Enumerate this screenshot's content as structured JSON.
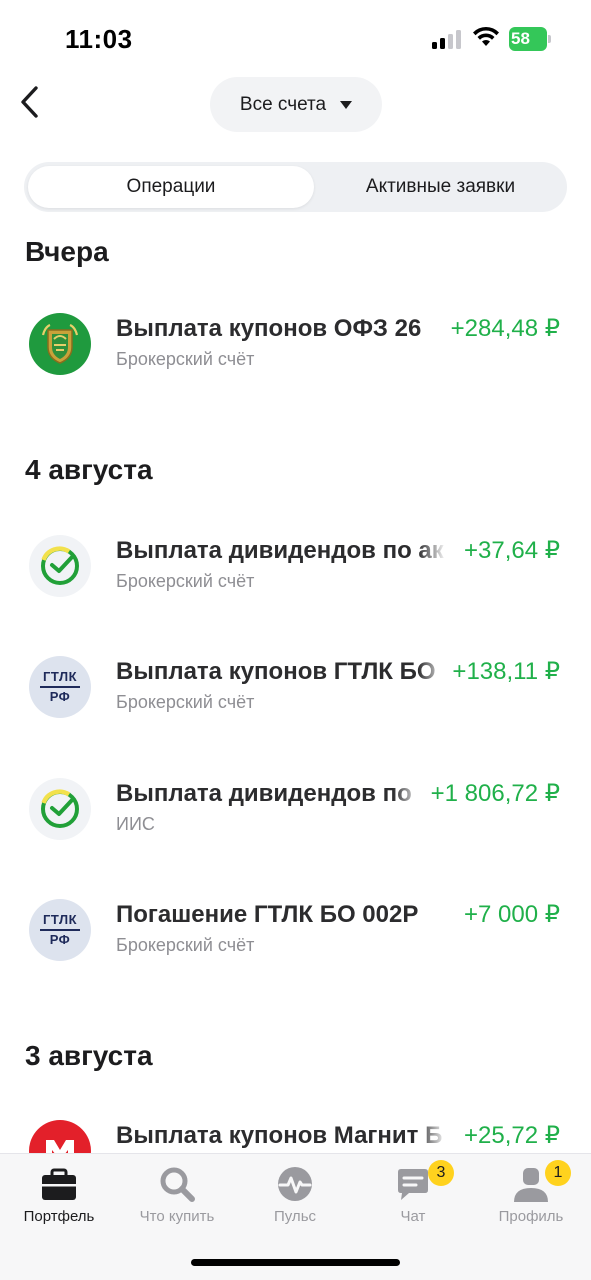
{
  "status_bar": {
    "time": "11:03",
    "battery": "58"
  },
  "header": {
    "account_selector": "Все счета"
  },
  "tabs": {
    "active": "Операции",
    "inactive": "Активные заявки"
  },
  "sections": [
    {
      "title": "Вчера"
    },
    {
      "title": "4 августа"
    },
    {
      "title": "3 августа"
    }
  ],
  "operations": [
    {
      "title": "Выплата купонов ОФЗ 26",
      "amount": "+284,48 ₽",
      "account": "Брокерский счёт",
      "logo": "ofz-emblem-icon"
    },
    {
      "title": "Выплата дивидендов по ак",
      "amount": "+37,64 ₽",
      "account": "Брокерский счёт",
      "logo": "sber-icon"
    },
    {
      "title": "Выплата купонов ГТЛК БО",
      "amount": "+138,11 ₽",
      "account": "Брокерский счёт",
      "logo": "gtlk-icon",
      "logo_text": [
        "ГТЛК",
        "РФ"
      ]
    },
    {
      "title": "Выплата дивидендов по",
      "amount": "+1 806,72 ₽",
      "account": "ИИС",
      "logo": "sber-icon"
    },
    {
      "title": "Погашение ГТЛК БО 002Р",
      "amount": "+7 000 ₽",
      "account": "Брокерский счёт",
      "logo": "gtlk-icon",
      "logo_text": [
        "ГТЛК",
        "РФ"
      ]
    },
    {
      "title": "Выплата купонов Магнит Б",
      "amount": "+25,72 ₽",
      "account": "",
      "logo": "magnit-icon"
    }
  ],
  "tabbar": {
    "items": [
      {
        "label": "Портфель",
        "icon": "briefcase-icon",
        "active": true
      },
      {
        "label": "Что купить",
        "icon": "search-icon"
      },
      {
        "label": "Пульс",
        "icon": "pulse-icon"
      },
      {
        "label": "Чат",
        "icon": "chat-icon",
        "badge": "3"
      },
      {
        "label": "Профиль",
        "icon": "profile-icon",
        "badge": "1"
      }
    ]
  },
  "colors": {
    "positive": "#20b04a",
    "badge": "#ffd21e",
    "sber_green": "#21a038"
  }
}
